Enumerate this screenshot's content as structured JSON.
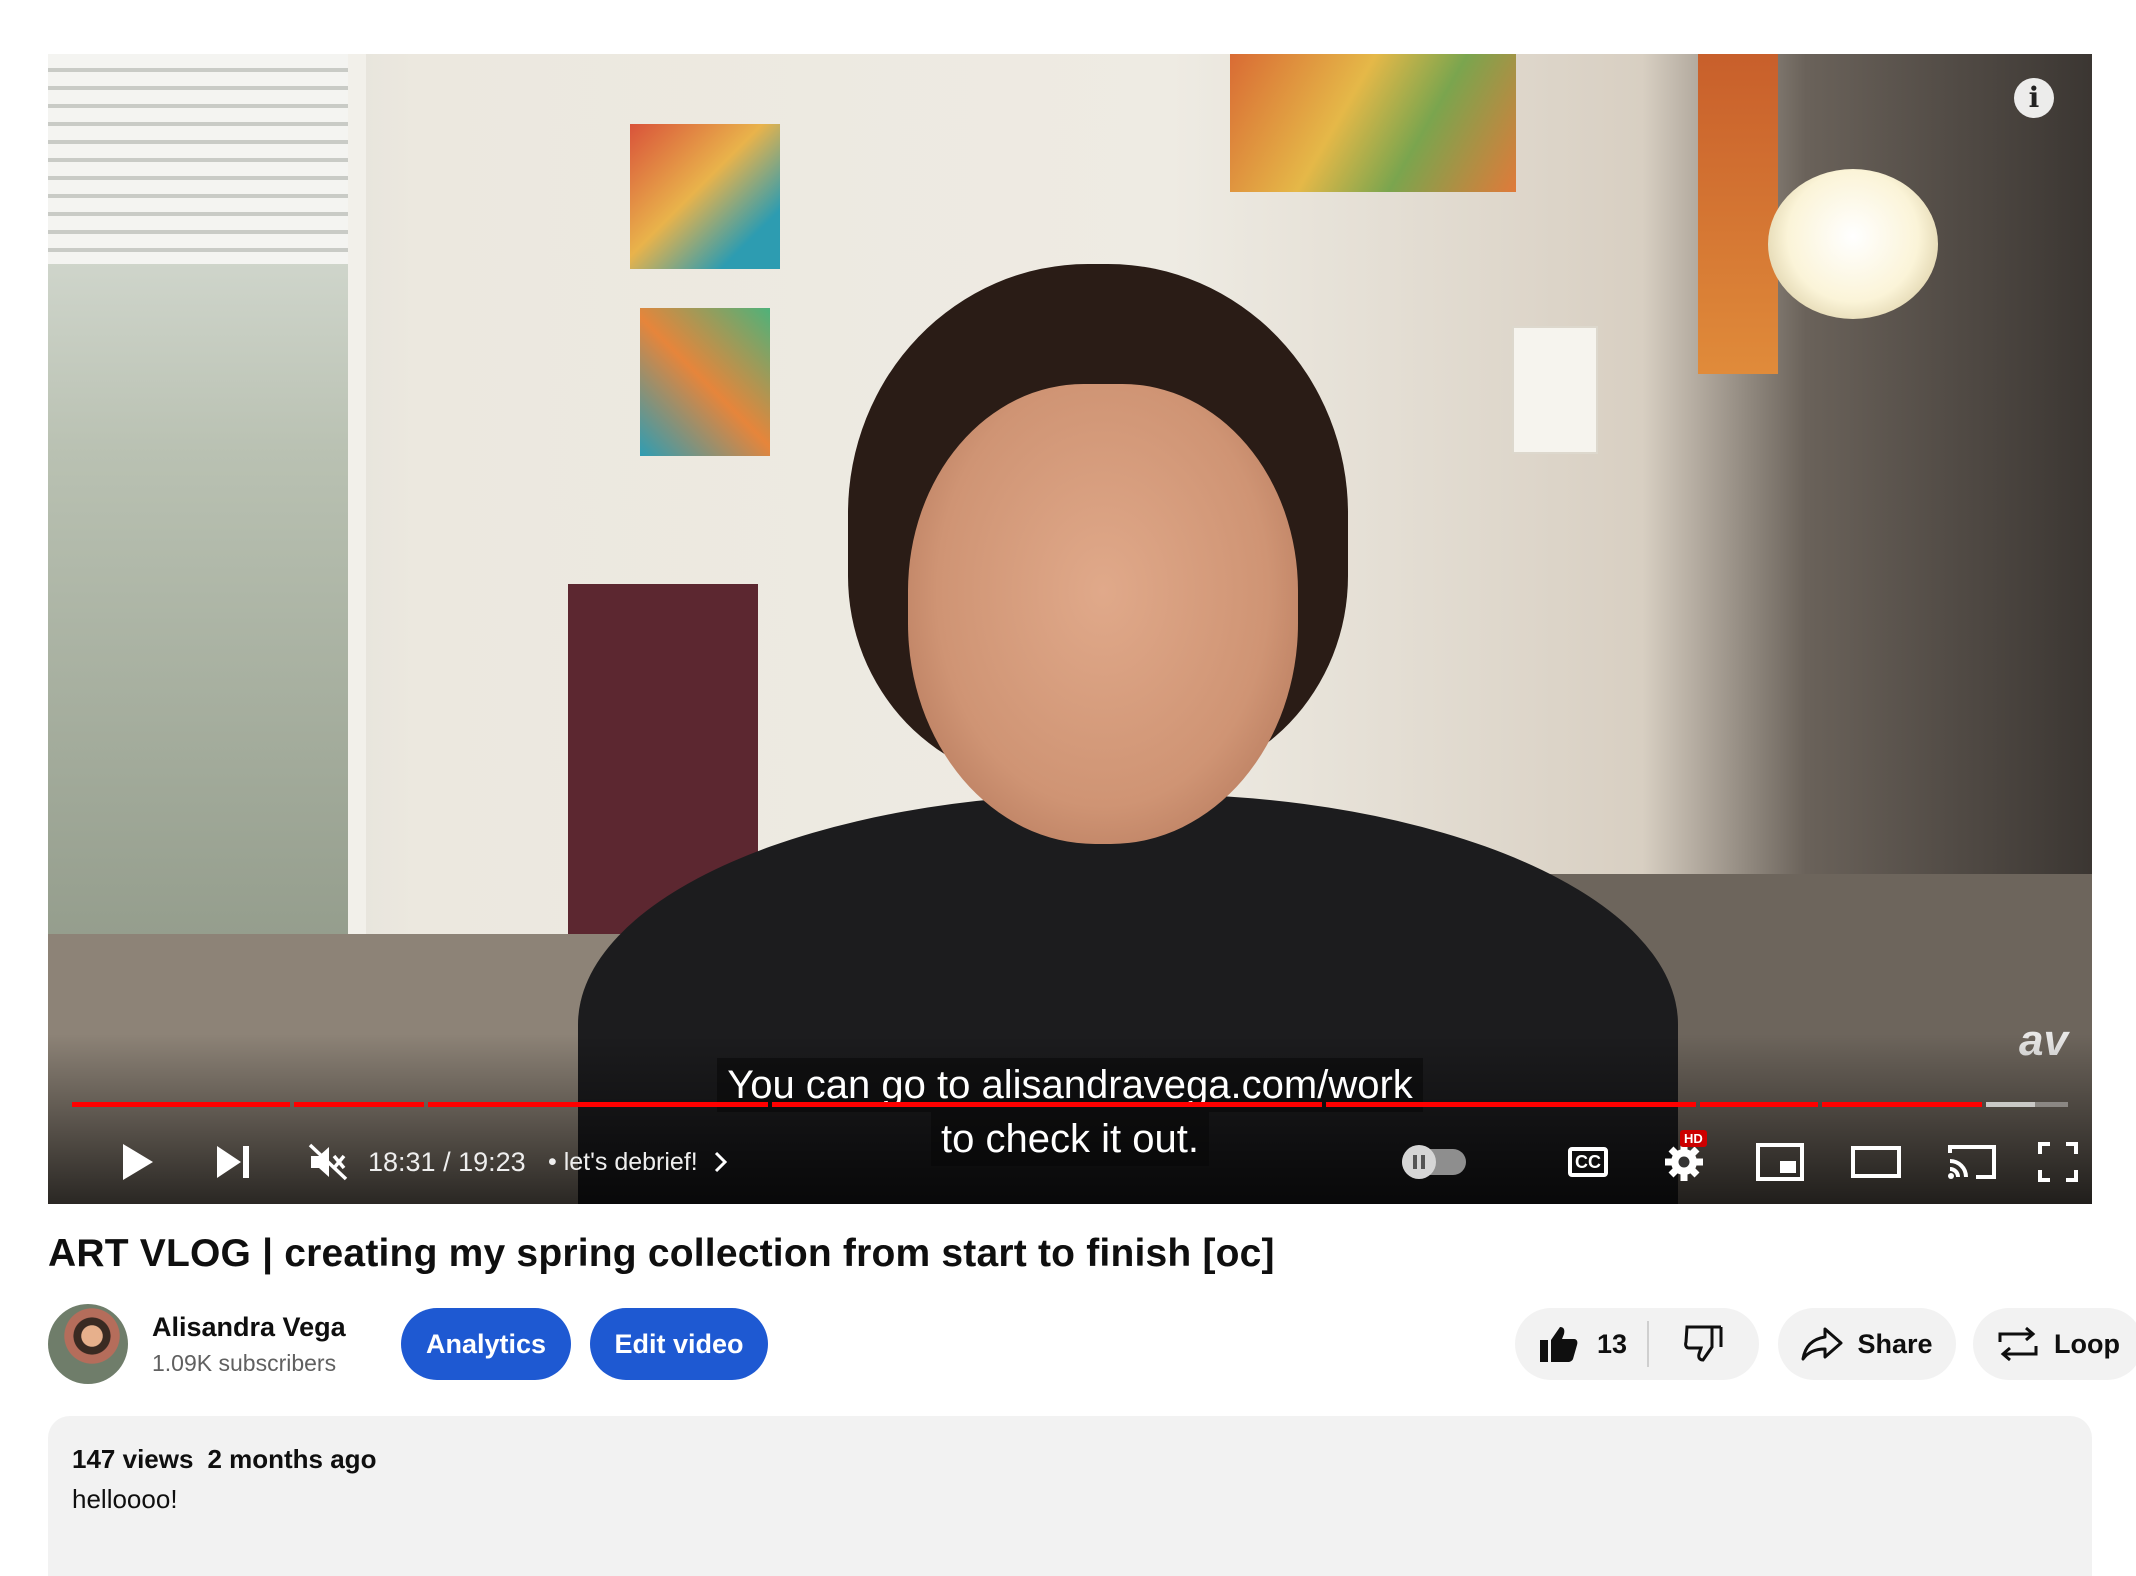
{
  "player": {
    "caption_line1": "You can go to alisandravega.com/work",
    "caption_line2": "to check it out.",
    "watermark": "av",
    "info_icon": "info-icon",
    "current_time": "18:31",
    "duration": "19:23",
    "time_separator": "/",
    "chapter_bullet": "•",
    "chapter_title": "let's debrief!",
    "progress_fraction": 0.952,
    "cc_label": "CC",
    "hd_badge": "HD",
    "accent_color": "#ff0000",
    "controls": [
      {
        "name": "play-button",
        "icon": "play-icon"
      },
      {
        "name": "next-button",
        "icon": "skip-next-icon"
      },
      {
        "name": "mute-button",
        "icon": "volume-muted-icon"
      },
      {
        "name": "autoplay-toggle",
        "icon": "pause-icon"
      },
      {
        "name": "subtitles-button",
        "icon": "cc-icon"
      },
      {
        "name": "settings-button",
        "icon": "gear-icon"
      },
      {
        "name": "miniplayer-button",
        "icon": "miniplayer-icon"
      },
      {
        "name": "theater-button",
        "icon": "theater-icon"
      },
      {
        "name": "cast-button",
        "icon": "cast-icon"
      },
      {
        "name": "fullscreen-button",
        "icon": "fullscreen-icon"
      }
    ]
  },
  "video": {
    "title": "ART VLOG | creating my spring collection from start to finish [oc]"
  },
  "channel": {
    "name": "Alisandra Vega",
    "subscribers": "1.09K subscribers"
  },
  "actions": {
    "analytics_label": "Analytics",
    "edit_label": "Edit video",
    "like_count": "13",
    "share_label": "Share",
    "loop_label": "Loop",
    "button_color": "#1e59d2"
  },
  "description": {
    "views": "147 views",
    "date": "2 months ago",
    "text": "helloooo!"
  }
}
